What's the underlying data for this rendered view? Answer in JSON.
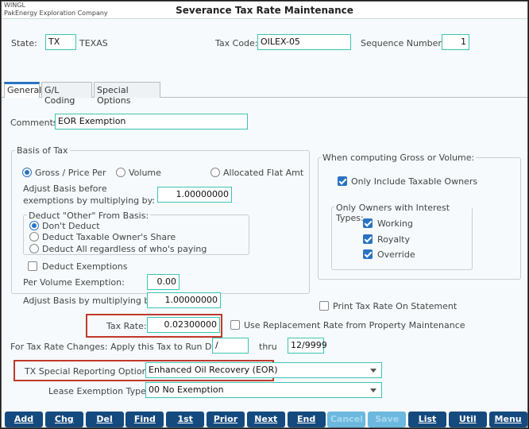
{
  "header": {
    "app": "WINGL",
    "company": "PakEnergy Exploration Company",
    "title": "Severance Tax Rate Maintenance"
  },
  "top": {
    "state_label": "State:",
    "state": "TX",
    "state_name": "TEXAS",
    "tax_code_label": "Tax Code:",
    "tax_code": "OILEX-05",
    "seq_label": "Sequence Number:",
    "seq": "1"
  },
  "tabs": [
    "General",
    "G/L Coding",
    "Special Options"
  ],
  "comments_label": "Comments:",
  "comments": "EOR Exemption",
  "basis": {
    "title": "Basis of Tax",
    "radios": [
      "Gross / Price Per",
      "Volume",
      "Allocated Flat Amt"
    ],
    "selected": "Gross / Price Per",
    "adjust_before_1": "Adjust Basis before",
    "adjust_before_2": "exemptions by multiplying by:",
    "adjust_before_value": "1.00000000",
    "deduct_title": "Deduct \"Other\" From Basis:",
    "deduct_options": [
      "Don't Deduct",
      "Deduct Taxable Owner's Share",
      "Deduct All regardless of who's paying"
    ],
    "deduct_exemptions": "Deduct Exemptions",
    "deduct_exemptions_checked": false,
    "per_volume_label": "Per Volume Exemption:",
    "per_volume": "0.00",
    "adjust_label": "Adjust Basis by multiplying by:",
    "adjust_value": "1.00000000"
  },
  "computing": {
    "title": "When computing Gross or Volume:",
    "only_taxable": "Only Include Taxable Owners",
    "only_taxable_checked": true,
    "interest_title": "Only Owners with Interest Types:",
    "types": [
      {
        "label": "Working",
        "checked": true
      },
      {
        "label": "Royalty",
        "checked": true
      },
      {
        "label": "Override",
        "checked": true
      }
    ]
  },
  "print_tax_rate": "Print Tax Rate On Statement",
  "print_tax_rate_checked": false,
  "tax_rate_label": "Tax Rate:",
  "tax_rate": "0.02300000",
  "replacement": "Use Replacement Rate from Property Maintenance",
  "replacement_checked": false,
  "run_dates_label": "For Tax Rate Changes: Apply this Tax to Run Dates:",
  "run_from": "/",
  "thru_label": "thru",
  "run_thru": "12/9999",
  "special_label": "TX Special Reporting Option:",
  "special_value": "Enhanced Oil Recovery (EOR)",
  "lease_label": "Lease Exemption Type:",
  "lease_value": "00 No Exemption",
  "buttons": [
    {
      "label": "Add",
      "enabled": true
    },
    {
      "label": "Chg",
      "enabled": true
    },
    {
      "label": "Del",
      "enabled": true
    },
    {
      "label": "Find",
      "enabled": true
    },
    {
      "label": "1st",
      "enabled": true
    },
    {
      "label": "Prior",
      "enabled": true
    },
    {
      "label": "Next",
      "enabled": true
    },
    {
      "label": "End",
      "enabled": true
    },
    {
      "label": "Cancel",
      "enabled": false
    },
    {
      "label": "Save",
      "enabled": false
    },
    {
      "label": "List",
      "enabled": true
    },
    {
      "label": "Util",
      "enabled": true
    },
    {
      "label": "Menu",
      "enabled": true
    }
  ]
}
